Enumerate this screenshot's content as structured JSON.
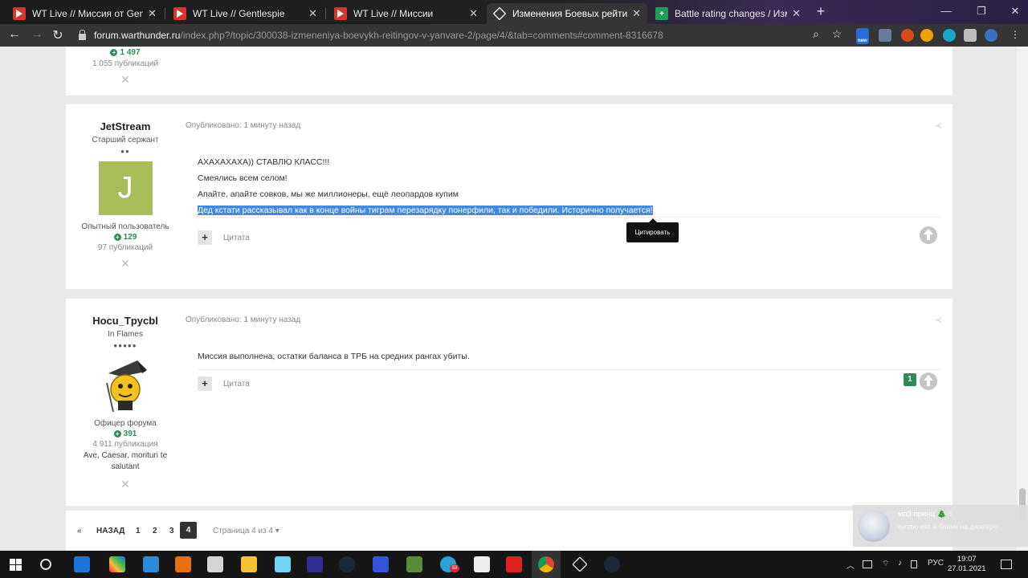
{
  "browser": {
    "tabs": [
      {
        "label": "WT Live // Миссия от Gentlespie",
        "favicon": "wt-icon"
      },
      {
        "label": "WT Live // Gentlespie",
        "favicon": "wt-icon"
      },
      {
        "label": "WT Live // Миссии",
        "favicon": "wt-icon"
      },
      {
        "label": "Изменения Боевых рейтингов в",
        "favicon": "warthunder-forum-icon"
      },
      {
        "label": "Battle rating changes / Изменен",
        "favicon": "sheets-icon"
      }
    ],
    "url_host": "forum.warthunder.ru",
    "url_path": "/index.php?/topic/300038-izmeneniya-boevykh-reitingov-v-yanvare-2/page/4/&tab=comments#comment-8316678",
    "ext_badge": "new"
  },
  "posts": [
    {
      "reputation": "1 497",
      "post_count": "1 055 публикаций"
    },
    {
      "username": "JetStream",
      "rank": "Старший сержант",
      "pips": "●●",
      "avatar_letter": "J",
      "avatar_color": "#a7be5a",
      "group": "Опытный пользователь",
      "reputation": "129",
      "post_count": "97 публикаций",
      "posted": "Опубликовано: 1 минуту назад",
      "lines": [
        "АХАХАХАХА)) СТАВЛЮ КЛАСС!!!",
        "Смеялись всем селом!",
        "Апайте, апайте совков, мы же миллионеры, ещё леопардов купим"
      ],
      "highlighted_line": "Дед кстати рассказывал как в конце войны тиграм перезарядку понерфили, так и победили. Исторично получается!",
      "quote_label": "Цитата",
      "tooltip": "Цитировать"
    },
    {
      "username": "Hocu_Tpycbl",
      "rank": "In Flames",
      "pips": "●●●●●",
      "group": "Офицер форума",
      "reputation": "391",
      "post_count": "4 911 публикация",
      "signature": "Ave, Caesar, morituri te salutant",
      "posted": "Опубликовано: 1 минуту назад",
      "lines": [
        "Миссия выполнена, остатки баланса в ТРБ на средних рангах убиты."
      ],
      "quote_label": "Цитата",
      "votes": "1"
    }
  ],
  "pagination": {
    "first": "«",
    "prev": "НАЗАД",
    "pages": [
      "1",
      "2",
      "3",
      "4"
    ],
    "current": "4",
    "info": "Страница 4 из 4 ▾"
  },
  "notification": {
    "name": "мп3 принц 🎄☃",
    "message": "куплю как в блинк на джагере"
  },
  "taskbar": {
    "lang": "РУС",
    "time": "19:07",
    "date": "27.01.2021",
    "telegram_badge": "59"
  },
  "colors": {
    "accent": "#2e8b57",
    "selection": "#3f8be3",
    "wt_red": "#d8352a"
  }
}
